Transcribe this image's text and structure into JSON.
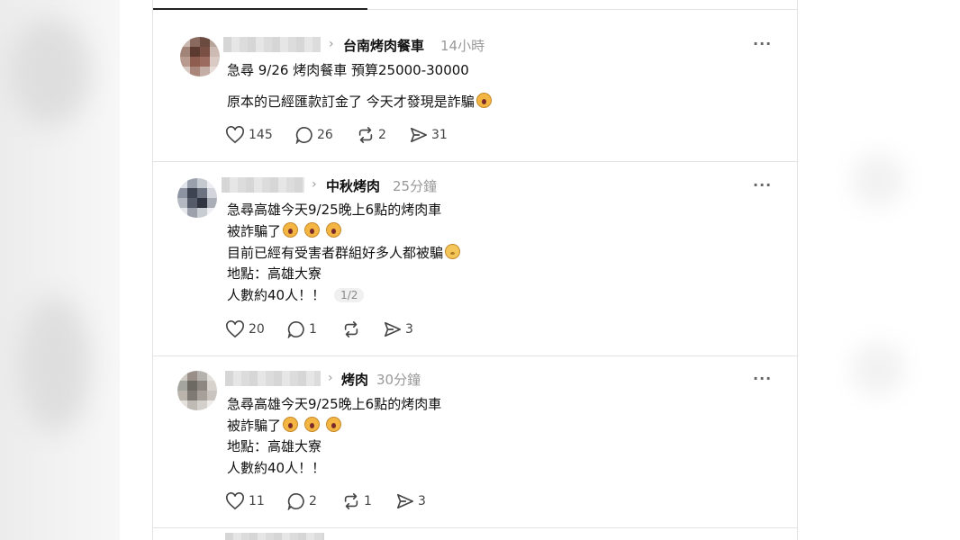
{
  "colors": {
    "text": "#111111",
    "muted": "#999999",
    "icon": "#444444",
    "divider": "#e3e3e3"
  },
  "posts": [
    {
      "topic": "台南烤肉餐車",
      "time": "14小時",
      "lines": [
        "急尋 9/26 烤肉餐車 預算25000-30000",
        "原本的已經匯款訂金了 今天才發現是詐騙"
      ],
      "stats": {
        "likes": "145",
        "replies": "26",
        "reposts": "2",
        "shares": "31"
      }
    },
    {
      "topic": "中秋烤肉",
      "time": "25分鐘",
      "lines": [
        "急尋高雄今天9/25晚上6點的烤肉車",
        "被詐騙了",
        "目前已經有受害者群組好多人都被騙",
        "地點：高雄大寮",
        "人數約40人！！"
      ],
      "page_indicator": "1/2",
      "stats": {
        "likes": "20",
        "replies": "1",
        "reposts": "",
        "shares": "3"
      }
    },
    {
      "topic": "烤肉",
      "time": "30分鐘",
      "lines": [
        "急尋高雄今天9/25晚上6點的烤肉車",
        "被詐騙了",
        "地點：高雄大寮",
        "人數約40人！！"
      ],
      "stats": {
        "likes": "11",
        "replies": "2",
        "reposts": "1",
        "shares": "3"
      }
    }
  ],
  "icons": {
    "chevron": "chevron-right-icon",
    "more": "more-horizontal-icon",
    "like": "heart-icon",
    "reply": "comment-icon",
    "repost": "repost-icon",
    "share": "send-icon",
    "emoji_scream": "screaming-face-emoji",
    "emoji_hug": "hugging-face-emoji"
  }
}
